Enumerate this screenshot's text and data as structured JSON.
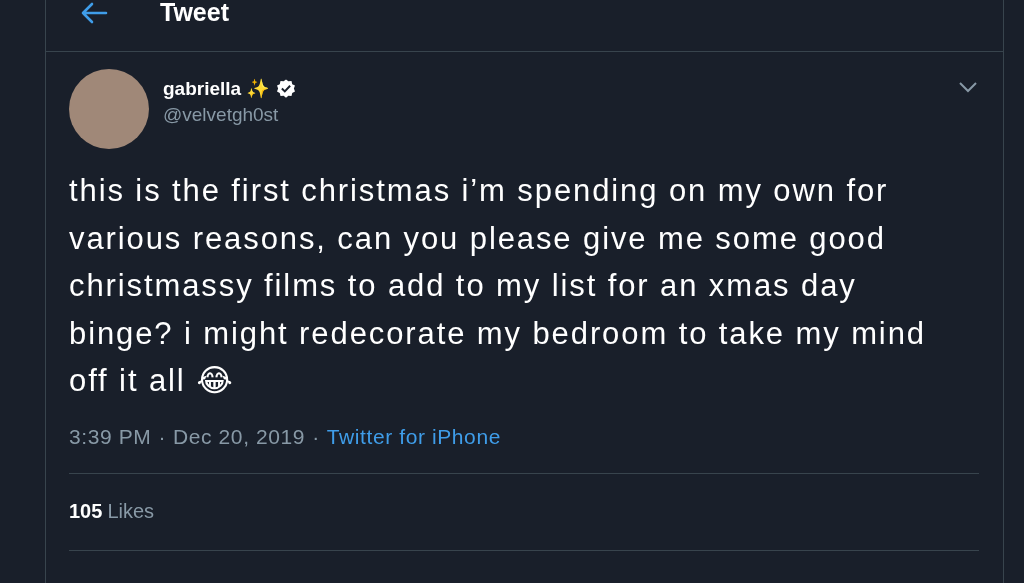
{
  "header": {
    "title": "Tweet"
  },
  "tweet": {
    "author": {
      "name": "gabriella ✨",
      "verified": true,
      "handle": "@velvetgh0st"
    },
    "text": "this is the first christmas i’m spending on my own for various reasons, can you please give me some good christmassy films to add to my list for an xmas day binge? i might redecorate my bedroom to take my mind off it all 😂",
    "time": "3:39 PM",
    "separator_1": "·",
    "date": "Dec 20, 2019",
    "separator_2": "·",
    "source": "Twitter for iPhone",
    "likes": {
      "count": "105",
      "label": "Likes"
    }
  }
}
